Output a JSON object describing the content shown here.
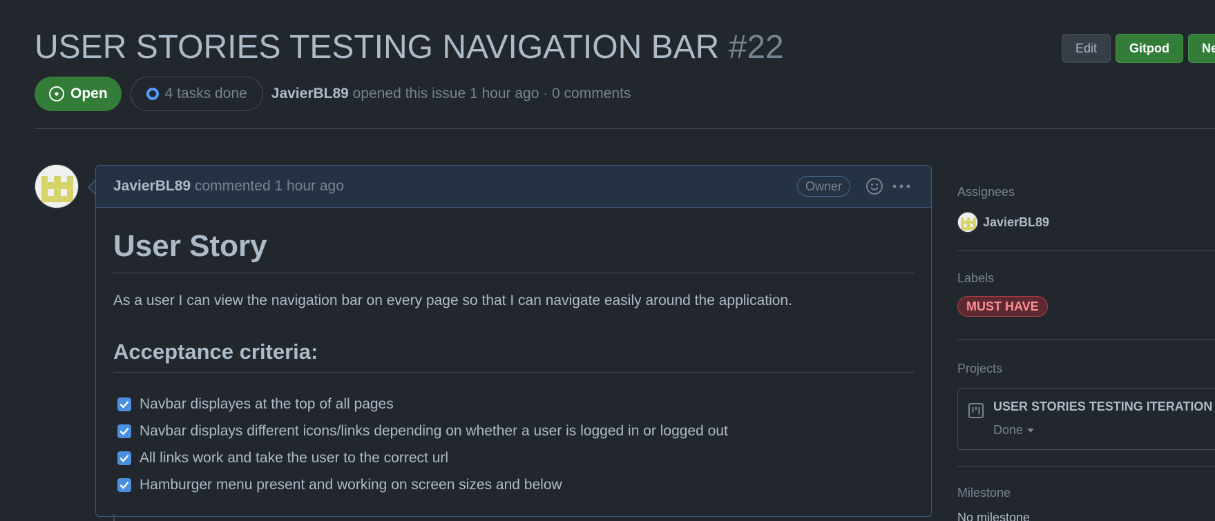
{
  "issue": {
    "title": "USER STORIES TESTING NAVIGATION BAR",
    "number": "#22",
    "state": "Open",
    "tasks": "4 tasks done",
    "author": "JavierBL89",
    "opened_text": " opened this issue 1 hour ago · 0 comments"
  },
  "header_actions": {
    "edit": "Edit",
    "gitpod": "Gitpod",
    "new": "New issue"
  },
  "comment": {
    "author": "JavierBL89",
    "meta": " commented 1 hour ago",
    "role_badge": "Owner",
    "heading": "User Story",
    "story": "As a user I can view the navigation bar on every page so that I can navigate easily around the application.",
    "criteria_heading": "Acceptance criteria:",
    "criteria": [
      "Navbar displayes at the top of all pages",
      "Navbar displays different icons/links depending on whether a user is logged in or logged out",
      "All links work and take the user to the correct url",
      "Hamburger menu present and working on screen sizes and below"
    ]
  },
  "sidebar": {
    "assignees_title": "Assignees",
    "assignee": "JavierBL89",
    "labels_title": "Labels",
    "label": "MUST HAVE",
    "projects_title": "Projects",
    "project_name": "USER STORIES TESTING ITERATION",
    "project_status": "Done",
    "milestone_title": "Milestone",
    "milestone_value": "No milestone"
  },
  "colors": {
    "accent_green": "#347d39",
    "accent_blue": "#539bf5",
    "label_red": "#ff8f96"
  }
}
